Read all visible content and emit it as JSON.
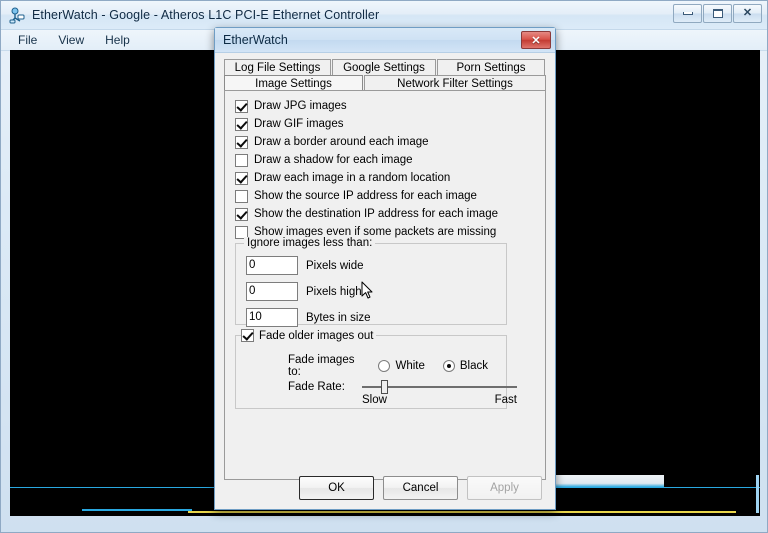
{
  "window": {
    "title": "EtherWatch - Google - Atheros L1C PCI-E Ethernet Controller",
    "icon": "network-adapter-icon",
    "controls": {
      "minimize": "minimize-button",
      "maximize": "restore-button",
      "close": "close-button"
    }
  },
  "menu": {
    "items": [
      {
        "label": "File"
      },
      {
        "label": "View"
      },
      {
        "label": "Help"
      }
    ]
  },
  "dialog": {
    "title": "EtherWatch",
    "close_glyph": "✕",
    "tabs": {
      "row1": [
        {
          "label": "Log File Settings",
          "selected": false
        },
        {
          "label": "Google Settings",
          "selected": false
        },
        {
          "label": "Porn Settings",
          "selected": false
        }
      ],
      "row2": [
        {
          "label": "Image Settings",
          "selected": true
        },
        {
          "label": "Network Filter Settings",
          "selected": false
        }
      ]
    },
    "checkboxes": [
      {
        "label": "Draw JPG images",
        "checked": true
      },
      {
        "label": "Draw GIF images",
        "checked": true
      },
      {
        "label": "Draw a border around each image",
        "checked": true
      },
      {
        "label": "Draw a shadow for each image",
        "checked": false
      },
      {
        "label": "Draw each image in a random location",
        "checked": true
      },
      {
        "label": "Show the source IP address for each image",
        "checked": false
      },
      {
        "label": "Show the destination IP address for each image",
        "checked": true
      },
      {
        "label": "Show images even if some packets are missing",
        "checked": false
      }
    ],
    "ignore_group": {
      "title": "Ignore images less than:",
      "fields": [
        {
          "value": "0",
          "label": "Pixels wide"
        },
        {
          "value": "0",
          "label": "Pixels high"
        },
        {
          "value": "10",
          "label": "Bytes in size"
        }
      ]
    },
    "fade_group": {
      "title": "Fade older images out",
      "enabled": true,
      "fade_to_label": "Fade images to:",
      "options": [
        {
          "label": "White",
          "selected": false
        },
        {
          "label": "Black",
          "selected": true
        }
      ],
      "rate_label": "Fade Rate:",
      "rate_min_label": "Slow",
      "rate_max_label": "Fast",
      "rate_percent": 12
    },
    "buttons": [
      {
        "label": "OK",
        "default": true,
        "enabled": true
      },
      {
        "label": "Cancel",
        "default": false,
        "enabled": true
      },
      {
        "label": "Apply",
        "default": false,
        "enabled": false
      }
    ]
  },
  "colors": {
    "dialog_face": "#f0f0f0",
    "client_background": "#000000",
    "accent_line": "#29a8e0",
    "artifact_yellow": "#e8d54a",
    "close_red": "#d9534a"
  }
}
